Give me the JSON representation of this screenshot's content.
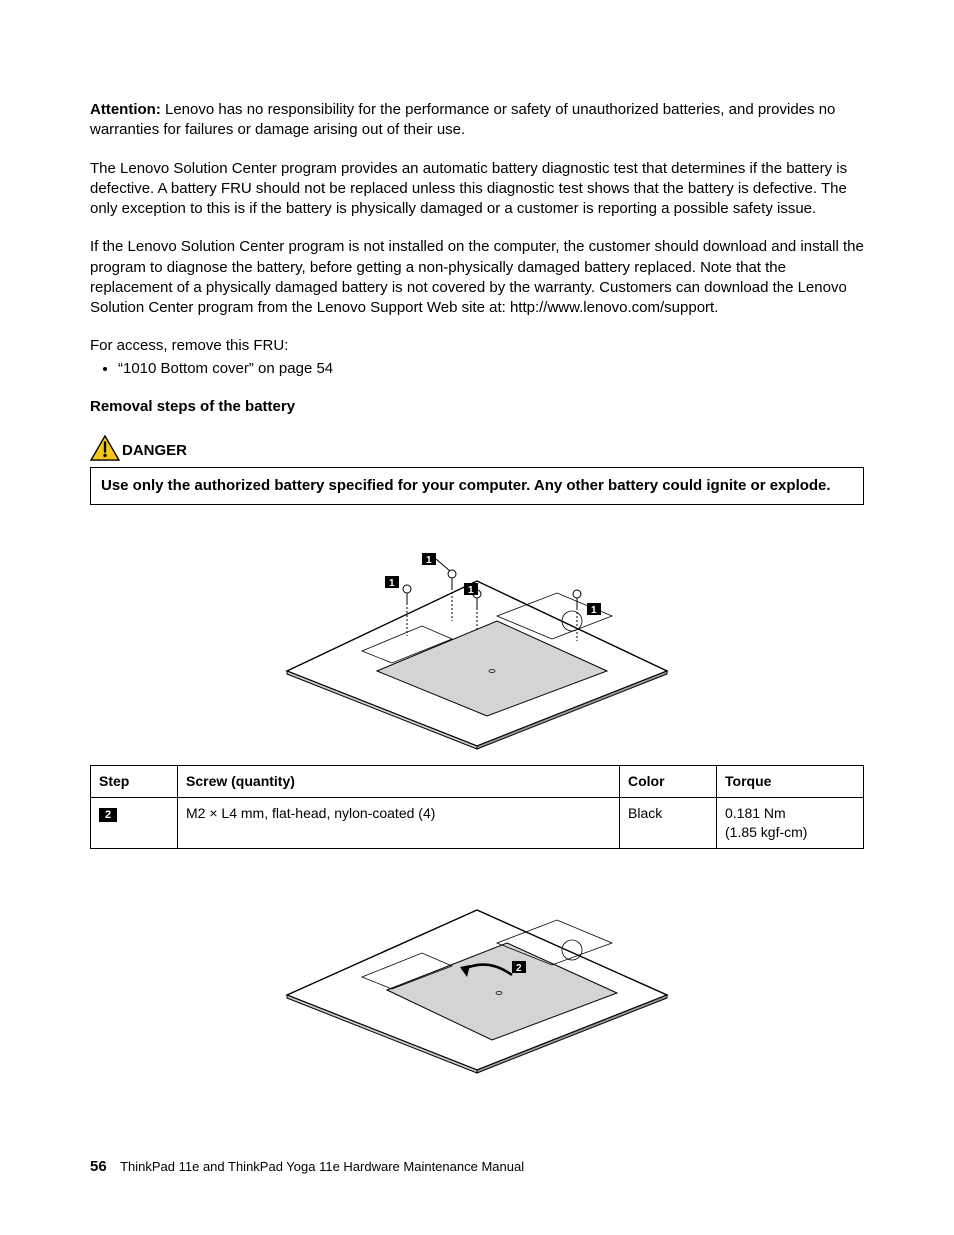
{
  "attention_label": "Attention:",
  "attention_body": " Lenovo has no responsibility for the performance or safety of unauthorized batteries, and provides no warranties for failures or damage arising out of their use.",
  "para_diag": "The Lenovo Solution Center program provides an automatic battery diagnostic test that determines if the battery is defective. A battery FRU should not be replaced unless this diagnostic test shows that the battery is defective. The only exception to this is if the battery is physically damaged or a customer is reporting a possible safety issue.",
  "para_install": "If the Lenovo Solution Center program is not installed on the computer, the customer should download and install the program to diagnose the battery, before getting a non-physically damaged battery replaced. Note that the replacement of a physically damaged battery is not covered by the warranty. Customers can download the Lenovo Solution Center program from the Lenovo Support Web site at: http://www.lenovo.com/support.",
  "access_line": "For access, remove this FRU:",
  "access_item": "“1010 Bottom cover” on page 54",
  "removal_heading": "Removal steps of the battery",
  "danger_label": "DANGER",
  "danger_text": "Use only the authorized battery specified for your computer. Any other battery could ignite or explode.",
  "callouts_fig1": [
    "1",
    "1",
    "1",
    "1"
  ],
  "callouts_fig2": [
    "2"
  ],
  "table": {
    "headers": {
      "step": "Step",
      "screw": "Screw (quantity)",
      "color": "Color",
      "torque": "Torque"
    },
    "rows": [
      {
        "step": "2",
        "screw": "M2 × L4 mm, flat-head, nylon-coated (4)",
        "color": "Black",
        "torque": "0.181 Nm\n(1.85 kgf-cm)"
      }
    ]
  },
  "footer": {
    "page_number": "56",
    "title": "ThinkPad 11e and ThinkPad Yoga 11e Hardware Maintenance Manual"
  }
}
